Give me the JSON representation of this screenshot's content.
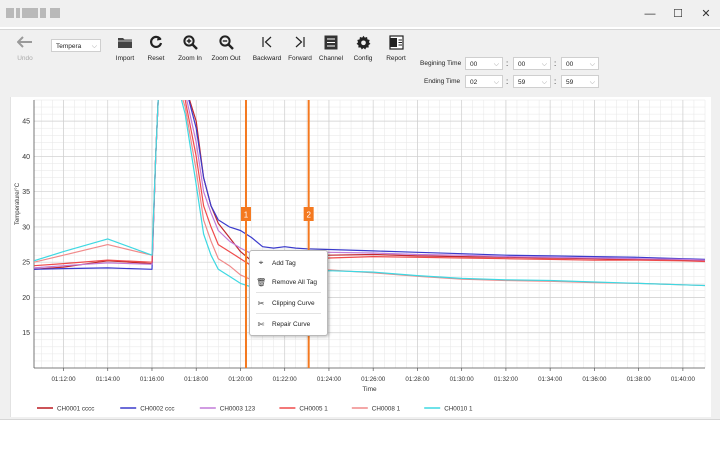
{
  "window": {
    "minimize_glyph": "—",
    "maximize_glyph": "☐",
    "close_glyph": "✕"
  },
  "toolbar": {
    "undo_label": "Undo",
    "channel_select_value": "Tempera",
    "import_label": "Import",
    "reset_label": "Reset",
    "zoom_in_label": "Zoom In",
    "zoom_out_label": "Zoom Out",
    "backward_label": "Backward",
    "forward_label": "Forward",
    "channel_label": "Channel",
    "config_label": "Config",
    "report_label": "Report",
    "begin_time_label": "Begining Time",
    "begin_hour": "00",
    "begin_minute": "00",
    "begin_second": "00",
    "end_time_label": "Ending Time",
    "end_hour": "02",
    "end_minute": "59",
    "end_second": "59",
    "time_sep": ":"
  },
  "context_menu": {
    "items": [
      {
        "label": "Add Tag",
        "icon": "tag-icon"
      },
      {
        "label": "Remove All Tag",
        "icon": "trash-icon"
      },
      {
        "label": "Clipping Curve",
        "icon": "scissors-icon"
      },
      {
        "label": "Repair Curve",
        "icon": "repair-icon"
      }
    ]
  },
  "colors": {
    "marker": "#f47920",
    "grid": "#e6e6e6"
  },
  "chart_data": {
    "type": "line",
    "xlabel": "Time",
    "ylabel": "Temperature/°C",
    "ylim": [
      10,
      48
    ],
    "xlim": [
      "01:10:40",
      "01:41:00"
    ],
    "x_ticks": [
      "01:12:00",
      "01:14:00",
      "01:16:00",
      "01:18:00",
      "01:20:00",
      "01:22:00",
      "01:24:00",
      "01:26:00",
      "01:28:00",
      "01:30:00",
      "01:32:00",
      "01:34:00",
      "01:36:00",
      "01:38:00",
      "01:40:00"
    ],
    "y_ticks": [
      15,
      20,
      25,
      30,
      35,
      40,
      45
    ],
    "grid": true,
    "legend_position": "bottom",
    "markers": [
      {
        "label": "1",
        "x": "01:20:15"
      },
      {
        "label": "2",
        "x": "01:23:05"
      }
    ],
    "series": [
      {
        "name": "CH0001  cccc",
        "color": "#c0282e",
        "x": [
          "01:10:40",
          "01:12:00",
          "01:14:00",
          "01:16:00",
          "01:16:10",
          "01:16:20",
          "01:16:30",
          "01:17:00",
          "01:17:30",
          "01:18:00",
          "01:18:20",
          "01:18:40",
          "01:19:00",
          "01:19:30",
          "01:20:00",
          "01:20:30",
          "01:21:00",
          "01:21:30",
          "01:22:00",
          "01:22:30",
          "01:23:00",
          "01:24:00",
          "01:26:00",
          "01:28:00",
          "01:30:00",
          "01:32:00",
          "01:34:00",
          "01:36:00",
          "01:38:00",
          "01:40:00",
          "01:41:00"
        ],
        "y": [
          24.0,
          24.3,
          25.2,
          24.8,
          40,
          52,
          52,
          52,
          50,
          45,
          37,
          33,
          30.5,
          28.5,
          26.5,
          25.2,
          24.2,
          24.5,
          24.8,
          25.4,
          25.8,
          26.0,
          26.1,
          25.9,
          25.8,
          25.7,
          25.6,
          25.5,
          25.4,
          25.3,
          25.2
        ]
      },
      {
        "name": "CH0002  ccc",
        "color": "#3b3bcc",
        "x": [
          "01:10:40",
          "01:12:00",
          "01:14:00",
          "01:16:00",
          "01:16:10",
          "01:16:20",
          "01:16:30",
          "01:17:00",
          "01:17:30",
          "01:18:00",
          "01:18:20",
          "01:18:40",
          "01:19:00",
          "01:19:30",
          "01:20:00",
          "01:20:30",
          "01:21:00",
          "01:21:30",
          "01:22:00",
          "01:22:30",
          "01:23:00",
          "01:24:00",
          "01:26:00",
          "01:28:00",
          "01:30:00",
          "01:32:00",
          "01:34:00",
          "01:36:00",
          "01:38:00",
          "01:40:00",
          "01:41:00"
        ],
        "y": [
          24.0,
          24.1,
          24.2,
          24.0,
          40,
          52,
          52,
          52,
          50,
          44,
          37,
          33,
          31,
          30,
          29.5,
          28.5,
          27.2,
          27.0,
          27.2,
          27.0,
          26.9,
          26.8,
          26.6,
          26.4,
          26.2,
          26.0,
          25.9,
          25.8,
          25.7,
          25.5,
          25.4
        ]
      },
      {
        "name": "CH0003  123",
        "color": "#c27bd8",
        "x": [
          "01:10:40",
          "01:12:00",
          "01:14:00",
          "01:16:00",
          "01:16:10",
          "01:16:20",
          "01:16:30",
          "01:17:00",
          "01:17:30",
          "01:18:00",
          "01:18:20",
          "01:18:40",
          "01:19:00",
          "01:19:30",
          "01:20:00",
          "01:20:30",
          "01:21:00",
          "01:21:30",
          "01:22:00",
          "01:22:30",
          "01:23:00",
          "01:24:00",
          "01:26:00",
          "01:28:00",
          "01:30:00",
          "01:32:00",
          "01:34:00",
          "01:36:00",
          "01:38:00",
          "01:40:00",
          "01:41:00"
        ],
        "y": [
          24.2,
          24.5,
          24.9,
          24.7,
          40,
          52,
          52,
          52,
          49,
          42,
          35,
          32,
          29.5,
          28,
          27,
          26.2,
          25.8,
          26.0,
          26.2,
          26.3,
          26.4,
          26.4,
          26.3,
          26.1,
          26.0,
          25.8,
          25.7,
          25.6,
          25.5,
          25.4,
          25.3
        ]
      },
      {
        "name": "CH0005  1",
        "color": "#ef4b4b",
        "x": [
          "01:10:40",
          "01:12:00",
          "01:14:00",
          "01:16:00",
          "01:16:10",
          "01:16:20",
          "01:16:30",
          "01:17:00",
          "01:17:30",
          "01:18:00",
          "01:18:20",
          "01:18:40",
          "01:19:00",
          "01:19:30",
          "01:20:00",
          "01:20:30",
          "01:21:00",
          "01:21:30",
          "01:22:00",
          "01:22:30",
          "01:23:00",
          "01:24:00",
          "01:26:00",
          "01:28:00",
          "01:30:00",
          "01:32:00",
          "01:34:00",
          "01:36:00",
          "01:38:00",
          "01:40:00",
          "01:41:00"
        ],
        "y": [
          24.5,
          24.8,
          25.3,
          25.0,
          40,
          52,
          52,
          52,
          48,
          40,
          33,
          30,
          27.5,
          26.5,
          25.5,
          24.5,
          23.5,
          23.7,
          24.2,
          24.8,
          25.3,
          25.6,
          25.8,
          25.7,
          25.6,
          25.5,
          25.4,
          25.3,
          25.3,
          25.2,
          25.1
        ]
      },
      {
        "name": "CH0008  1",
        "color": "#f08a8a",
        "x": [
          "01:10:40",
          "01:12:00",
          "01:14:00",
          "01:16:00",
          "01:16:10",
          "01:16:20",
          "01:16:30",
          "01:17:00",
          "01:17:30",
          "01:18:00",
          "01:18:20",
          "01:18:40",
          "01:19:00",
          "01:19:30",
          "01:20:00",
          "01:20:30",
          "01:21:00",
          "01:21:30",
          "01:22:00",
          "01:22:30",
          "01:23:00",
          "01:24:00",
          "01:26:00",
          "01:28:00",
          "01:30:00",
          "01:32:00",
          "01:34:00",
          "01:36:00",
          "01:38:00",
          "01:40:00",
          "01:41:00"
        ],
        "y": [
          25.0,
          26.0,
          27.5,
          26.0,
          40,
          52,
          52,
          52,
          47,
          38,
          31,
          28,
          25.5,
          24.5,
          23.2,
          22.5,
          22.2,
          22.3,
          22.8,
          23.2,
          23.6,
          23.9,
          23.5,
          23.0,
          22.6,
          22.4,
          22.3,
          22.1,
          22.0,
          21.8,
          21.7
        ]
      },
      {
        "name": "CH0010  1",
        "color": "#3ed8e2",
        "x": [
          "01:10:40",
          "01:12:00",
          "01:14:00",
          "01:16:00",
          "01:16:10",
          "01:16:20",
          "01:16:30",
          "01:17:00",
          "01:17:30",
          "01:18:00",
          "01:18:20",
          "01:18:40",
          "01:19:00",
          "01:19:30",
          "01:20:00",
          "01:20:30",
          "01:21:00",
          "01:21:30",
          "01:22:00",
          "01:22:30",
          "01:23:00",
          "01:24:00",
          "01:26:00",
          "01:28:00",
          "01:30:00",
          "01:32:00",
          "01:34:00",
          "01:36:00",
          "01:38:00",
          "01:40:00",
          "01:41:00"
        ],
        "y": [
          25.2,
          26.5,
          28.3,
          26.0,
          40,
          52,
          52,
          52,
          46,
          36,
          29,
          26,
          24,
          23,
          22.0,
          21.5,
          21.8,
          22.3,
          22.7,
          23.0,
          23.5,
          23.8,
          23.6,
          23.1,
          22.7,
          22.5,
          22.4,
          22.2,
          22.0,
          21.8,
          21.7
        ]
      }
    ]
  }
}
